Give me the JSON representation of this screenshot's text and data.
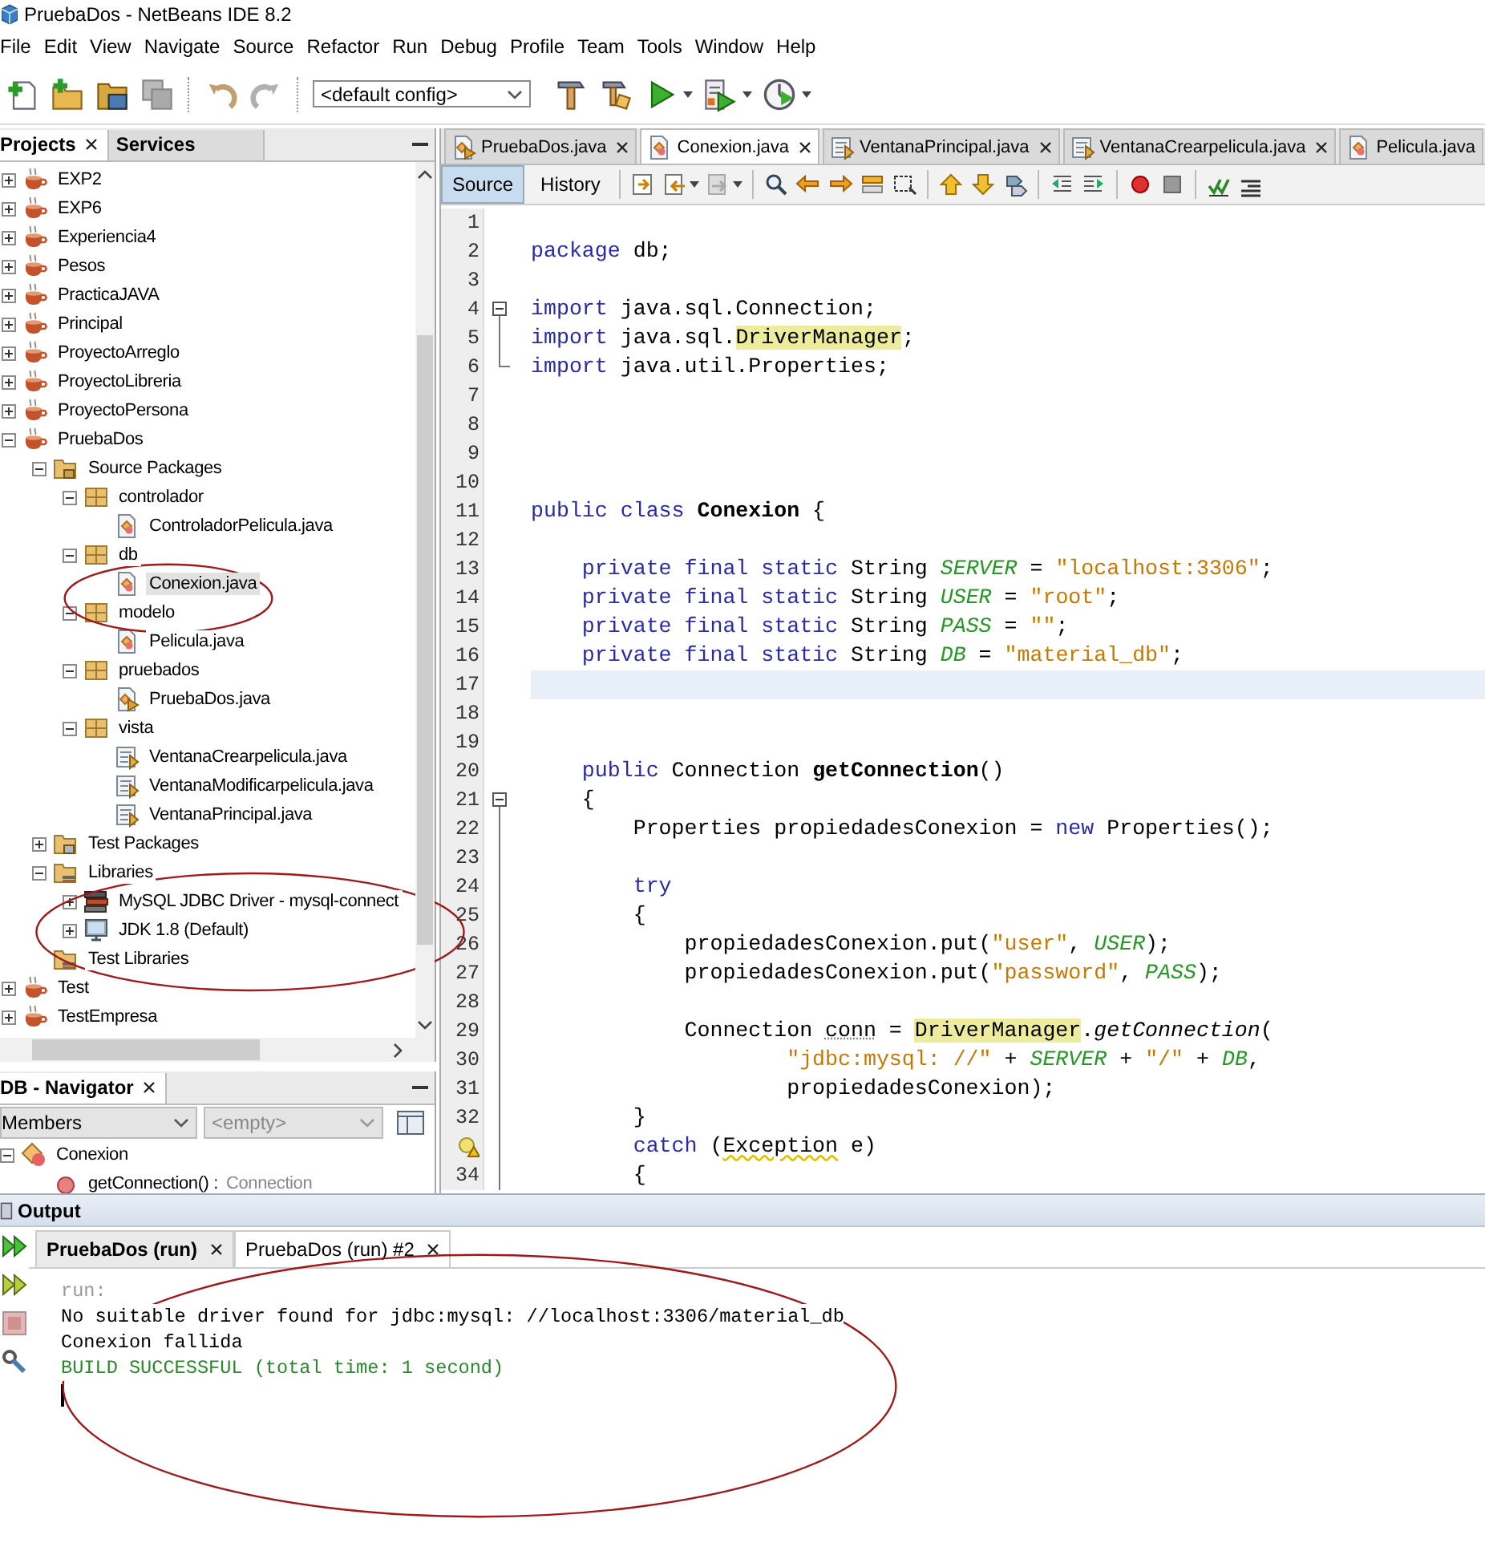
{
  "window": {
    "title": "PruebaDos - NetBeans IDE 8.2"
  },
  "menu": [
    "File",
    "Edit",
    "View",
    "Navigate",
    "Source",
    "Refactor",
    "Run",
    "Debug",
    "Profile",
    "Team",
    "Tools",
    "Window",
    "Help"
  ],
  "toolbar": {
    "config": "<default config>"
  },
  "projects_panel": {
    "tabs": [
      {
        "label": "Projects",
        "selected": true
      },
      {
        "label": "Services",
        "selected": false
      }
    ],
    "tree": [
      {
        "label": "EXP2",
        "kind": "project",
        "expanded": false,
        "selected": false
      },
      {
        "label": "EXP6",
        "kind": "project",
        "expanded": false,
        "selected": false
      },
      {
        "label": "Experiencia4",
        "kind": "project",
        "expanded": false,
        "selected": false
      },
      {
        "label": "Pesos",
        "kind": "project",
        "expanded": false,
        "selected": false
      },
      {
        "label": "PracticaJAVA",
        "kind": "project",
        "expanded": false,
        "selected": false
      },
      {
        "label": "Principal",
        "kind": "project",
        "expanded": false,
        "selected": false
      },
      {
        "label": "ProyectoArreglo",
        "kind": "project",
        "expanded": false,
        "selected": false
      },
      {
        "label": "ProyectoLibreria",
        "kind": "project",
        "expanded": false,
        "selected": false
      },
      {
        "label": "ProyectoPersona",
        "kind": "project",
        "expanded": false,
        "selected": false
      },
      {
        "label": "PruebaDos",
        "kind": "project",
        "expanded": true,
        "selected": false,
        "children": [
          {
            "label": "Source Packages",
            "kind": "folder",
            "expanded": true,
            "selected": false,
            "children": [
              {
                "label": "controlador",
                "kind": "package",
                "expanded": true,
                "selected": false,
                "children": [
                  {
                    "label": "ControladorPelicula.java",
                    "kind": "class",
                    "selected": false
                  }
                ]
              },
              {
                "label": "db",
                "kind": "package",
                "expanded": true,
                "selected": false,
                "children": [
                  {
                    "label": "Conexion.java",
                    "kind": "class",
                    "selected": true,
                    "circled": true
                  }
                ]
              },
              {
                "label": "modelo",
                "kind": "package",
                "expanded": true,
                "selected": false,
                "children": [
                  {
                    "label": "Pelicula.java",
                    "kind": "class",
                    "selected": false
                  }
                ]
              },
              {
                "label": "pruebados",
                "kind": "package",
                "expanded": true,
                "selected": false,
                "children": [
                  {
                    "label": "PruebaDos.java",
                    "kind": "main",
                    "selected": false
                  }
                ]
              },
              {
                "label": "vista",
                "kind": "package",
                "expanded": true,
                "selected": false,
                "children": [
                  {
                    "label": "VentanaCrearpelicula.java",
                    "kind": "form",
                    "selected": false
                  },
                  {
                    "label": "VentanaModificarpelicula.java",
                    "kind": "form",
                    "selected": false
                  },
                  {
                    "label": "VentanaPrincipal.java",
                    "kind": "form",
                    "selected": false
                  }
                ]
              }
            ]
          },
          {
            "label": "Test Packages",
            "kind": "testfolder",
            "expanded": false,
            "selected": false
          },
          {
            "label": "Libraries",
            "kind": "libfolder",
            "expanded": true,
            "selected": false,
            "circled": true,
            "children": [
              {
                "label": "MySQL JDBC Driver - mysql-connect",
                "kind": "jar",
                "expanded": false,
                "selected": false
              },
              {
                "label": "JDK 1.8 (Default)",
                "kind": "jdk",
                "expanded": false,
                "selected": false
              }
            ]
          },
          {
            "label": "Test Libraries",
            "kind": "libfolder",
            "selected": false
          }
        ]
      },
      {
        "label": "Test",
        "kind": "project",
        "expanded": false,
        "selected": false
      },
      {
        "label": "TestEmpresa",
        "kind": "project",
        "expanded": false,
        "selected": false
      }
    ]
  },
  "navigator": {
    "title": "DB - Navigator",
    "filter": "Members",
    "scope": {
      "value": "<empty>",
      "disabled": true
    },
    "tree": [
      {
        "label": "Conexion",
        "kind": "class",
        "expanded": true,
        "children": [
          {
            "label": "getConnection() :",
            "type": "Connection",
            "kind": "method"
          }
        ]
      }
    ]
  },
  "editor": {
    "tabs": [
      {
        "label": "PruebaDos.java",
        "kind": "main",
        "selected": false,
        "closable": true
      },
      {
        "label": "Conexion.java",
        "kind": "class",
        "selected": true,
        "closable": true
      },
      {
        "label": "VentanaPrincipal.java",
        "kind": "form",
        "selected": false,
        "closable": true
      },
      {
        "label": "VentanaCrearpelicula.java",
        "kind": "form",
        "selected": false,
        "closable": true
      },
      {
        "label": "Pelicula.java",
        "kind": "class",
        "selected": false,
        "closable": false
      }
    ],
    "views": [
      {
        "label": "Source",
        "selected": true
      },
      {
        "label": "History",
        "selected": false
      }
    ],
    "lines": [
      {
        "number": "1",
        "kind": "plain",
        "current": false
      },
      {
        "number": "2",
        "kind": "plain",
        "current": false,
        "tokens": [
          {
            "kw": "package"
          },
          {
            "text": " db;"
          }
        ]
      },
      {
        "number": "3",
        "kind": "plain",
        "current": false
      },
      {
        "number": "4",
        "kind": "open",
        "current": false,
        "tokens": [
          {
            "kw": "import"
          },
          {
            "text": " java.sql.Connection;"
          }
        ]
      },
      {
        "number": "5",
        "kind": "inner",
        "current": false,
        "tokens": [
          {
            "kw": "import"
          },
          {
            "text": " java.sql."
          },
          {
            "mark": "DriverManager"
          },
          {
            "text": ";"
          }
        ]
      },
      {
        "number": "6",
        "kind": "close",
        "current": false,
        "tokens": [
          {
            "kw": "import"
          },
          {
            "text": " java.util.Properties;"
          }
        ]
      },
      {
        "number": "7",
        "kind": "plain",
        "current": false
      },
      {
        "number": "8",
        "kind": "plain",
        "current": false
      },
      {
        "number": "9",
        "kind": "plain",
        "current": false
      },
      {
        "number": "10",
        "kind": "plain",
        "current": false
      },
      {
        "number": "11",
        "kind": "plain",
        "current": false,
        "tokens": [
          {
            "kw": "public class "
          },
          {
            "decl": "Conexion"
          },
          {
            "text": " {"
          }
        ]
      },
      {
        "number": "12",
        "kind": "plain",
        "current": false
      },
      {
        "number": "13",
        "kind": "plain",
        "current": false,
        "tokens": [
          {
            "kw": "    private final static"
          },
          {
            "text": " String "
          },
          {
            "field": "SERVER"
          },
          {
            "text": " = "
          },
          {
            "str": "\"localhost:3306\""
          },
          {
            "text": ";"
          }
        ]
      },
      {
        "number": "14",
        "kind": "plain",
        "current": false,
        "tokens": [
          {
            "kw": "    private final static"
          },
          {
            "text": " String "
          },
          {
            "field": "USER"
          },
          {
            "text": " = "
          },
          {
            "str": "\"root\""
          },
          {
            "text": ";"
          }
        ]
      },
      {
        "number": "15",
        "kind": "plain",
        "current": false,
        "tokens": [
          {
            "kw": "    private final static"
          },
          {
            "text": " String "
          },
          {
            "field": "PASS"
          },
          {
            "text": " = "
          },
          {
            "str": "\"\""
          },
          {
            "text": ";"
          }
        ]
      },
      {
        "number": "16",
        "kind": "plain",
        "current": false,
        "tokens": [
          {
            "kw": "    private final static"
          },
          {
            "text": " String "
          },
          {
            "field": "DB"
          },
          {
            "text": " = "
          },
          {
            "str": "\"material_db\""
          },
          {
            "text": ";"
          }
        ]
      },
      {
        "number": "17",
        "kind": "plain",
        "current": true
      },
      {
        "number": "18",
        "kind": "plain",
        "current": false
      },
      {
        "number": "19",
        "kind": "plain",
        "current": false
      },
      {
        "number": "20",
        "kind": "plain",
        "current": false,
        "tokens": [
          {
            "kw": "    public"
          },
          {
            "text": " Connection "
          },
          {
            "decl": "getConnection"
          },
          {
            "text": "()"
          }
        ]
      },
      {
        "number": "21",
        "kind": "open",
        "current": false,
        "tokens": [
          {
            "text": "    {"
          }
        ]
      },
      {
        "number": "22",
        "kind": "inner",
        "current": false,
        "tokens": [
          {
            "text": "        Properties propiedadesConexion = "
          },
          {
            "kw": "new"
          },
          {
            "text": " Properties();"
          }
        ]
      },
      {
        "number": "23",
        "kind": "inner",
        "current": false
      },
      {
        "number": "24",
        "kind": "inner",
        "current": false,
        "tokens": [
          {
            "kw": "        try"
          }
        ]
      },
      {
        "number": "25",
        "kind": "inner",
        "current": false,
        "tokens": [
          {
            "text": "        {"
          }
        ]
      },
      {
        "number": "26",
        "kind": "inner",
        "current": false,
        "tokens": [
          {
            "text": "            propiedadesConexion.put("
          },
          {
            "str": "\"user\""
          },
          {
            "text": ", "
          },
          {
            "field": "USER"
          },
          {
            "text": ");"
          }
        ]
      },
      {
        "number": "27",
        "kind": "inner",
        "current": false,
        "tokens": [
          {
            "text": "            propiedadesConexion.put("
          },
          {
            "str": "\"password\""
          },
          {
            "text": ", "
          },
          {
            "field": "PASS"
          },
          {
            "text": ");"
          }
        ]
      },
      {
        "number": "28",
        "kind": "inner",
        "current": false
      },
      {
        "number": "29",
        "kind": "inner",
        "current": false,
        "tokens": [
          {
            "text": "            Connection "
          },
          {
            "unused": "conn"
          },
          {
            "text": " = "
          },
          {
            "mark": "DriverManager"
          },
          {
            "text": "."
          },
          {
            "call": "getConnection"
          },
          {
            "text": "("
          }
        ]
      },
      {
        "number": "30",
        "kind": "inner",
        "current": false,
        "tokens": [
          {
            "str": "                    \"jdbc:mysql: //\""
          },
          {
            "text": " + "
          },
          {
            "field": "SERVER"
          },
          {
            "text": " + "
          },
          {
            "str": "\"/\""
          },
          {
            "text": " + "
          },
          {
            "field": "DB"
          },
          {
            "text": ","
          }
        ]
      },
      {
        "number": "31",
        "kind": "inner",
        "current": false,
        "tokens": [
          {
            "text": "                    propiedadesConexion);"
          }
        ]
      },
      {
        "number": "32",
        "kind": "inner",
        "current": false,
        "tokens": [
          {
            "text": "        }"
          }
        ]
      },
      {
        "kind": "inner",
        "current": false,
        "tokens": [
          {
            "kw": "        catch"
          },
          {
            "text": " ("
          },
          {
            "warn": "Exception"
          },
          {
            "text": " e)"
          }
        ]
      },
      {
        "number": "34",
        "kind": "inner",
        "current": false,
        "tokens": [
          {
            "text": "        {"
          }
        ]
      }
    ]
  },
  "output": {
    "title": "Output",
    "circled": true,
    "tabs": [
      {
        "label": "PruebaDos (run)",
        "selected": false
      },
      {
        "label": "PruebaDos (run) #2",
        "selected": true
      }
    ],
    "lines": [
      {
        "kind": "info",
        "text": "run:"
      },
      {
        "kind": "normal",
        "text": "No suitable driver found for jdbc:mysql: //localhost:3306/material_db"
      },
      {
        "kind": "normal",
        "text": "Conexion fallida"
      },
      {
        "kind": "success",
        "text": "BUILD SUCCESSFUL (total time: 1 second)"
      }
    ]
  }
}
